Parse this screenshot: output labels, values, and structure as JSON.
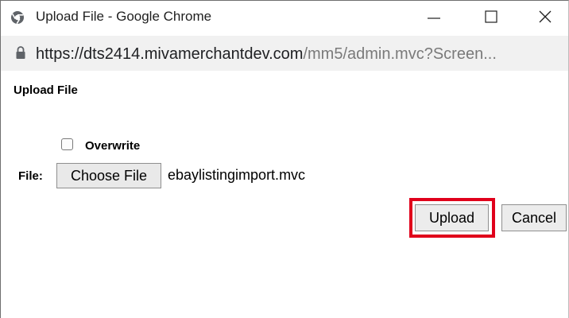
{
  "window": {
    "title": "Upload File - Google Chrome",
    "browser_icon": "chrome-globe-icon",
    "controls": {
      "minimize_icon": "minimize-icon",
      "maximize_icon": "maximize-icon",
      "close_icon": "close-icon"
    }
  },
  "address_bar": {
    "lock_icon": "lock-icon",
    "url_host": "https://dts2414.mivamerchantdev.com",
    "url_path": "/mm5/admin.mvc?Screen..."
  },
  "page": {
    "heading": "Upload File",
    "overwrite": {
      "label": "Overwrite",
      "checked": false
    },
    "file": {
      "label": "File:",
      "choose_button": "Choose File",
      "selected_file": "ebaylistingimport.mvc"
    },
    "actions": {
      "upload_label": "Upload",
      "cancel_label": "Cancel"
    },
    "highlight_color": "#e0001b"
  }
}
